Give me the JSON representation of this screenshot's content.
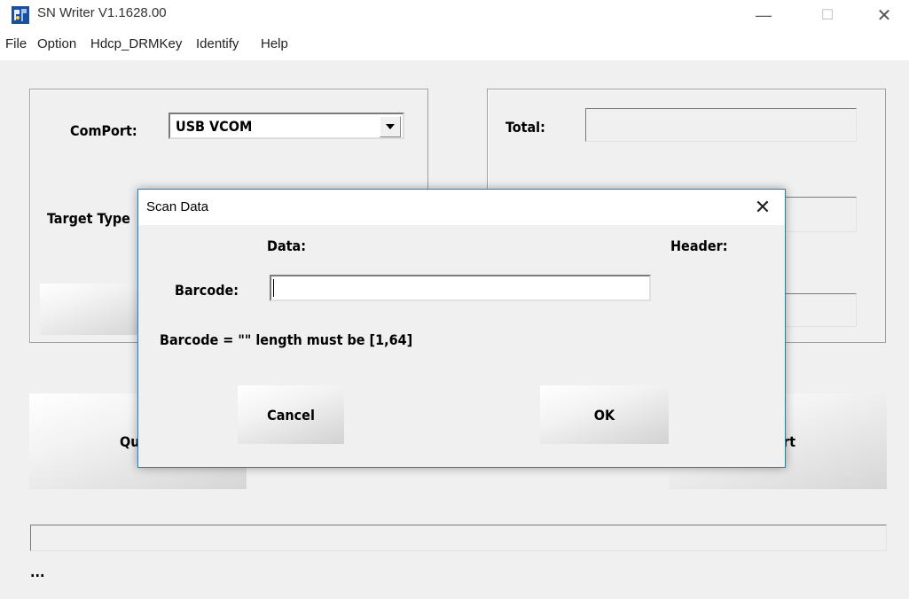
{
  "window": {
    "title": "SN Writer V1.1628.00",
    "controls": {
      "minimize": "—",
      "maximize": "☐",
      "close": "✕"
    }
  },
  "menu": [
    "File",
    "Option",
    "Hdcp_DRMKey",
    "Identify",
    "Help"
  ],
  "left_panel": {
    "comport_label": "ComPort:",
    "comport_value": "USB VCOM",
    "target_type_label": "Target Type"
  },
  "right_panel": {
    "total_label": "Total:",
    "total_value": ""
  },
  "buttons": {
    "quit_label": "Qu",
    "start_label": "rt"
  },
  "status": {
    "text": "..."
  },
  "dialog": {
    "title": "Scan Data",
    "close": "✕",
    "data_label": "Data:",
    "header_label": "Header:",
    "barcode_label": "Barcode:",
    "barcode_value": "",
    "message": "Barcode = \"\" length must be [1,64]",
    "cancel_label": "Cancel",
    "ok_label": "OK"
  },
  "colors": {
    "dialog_border": "#1883d7",
    "face": "#f0f0f0"
  }
}
